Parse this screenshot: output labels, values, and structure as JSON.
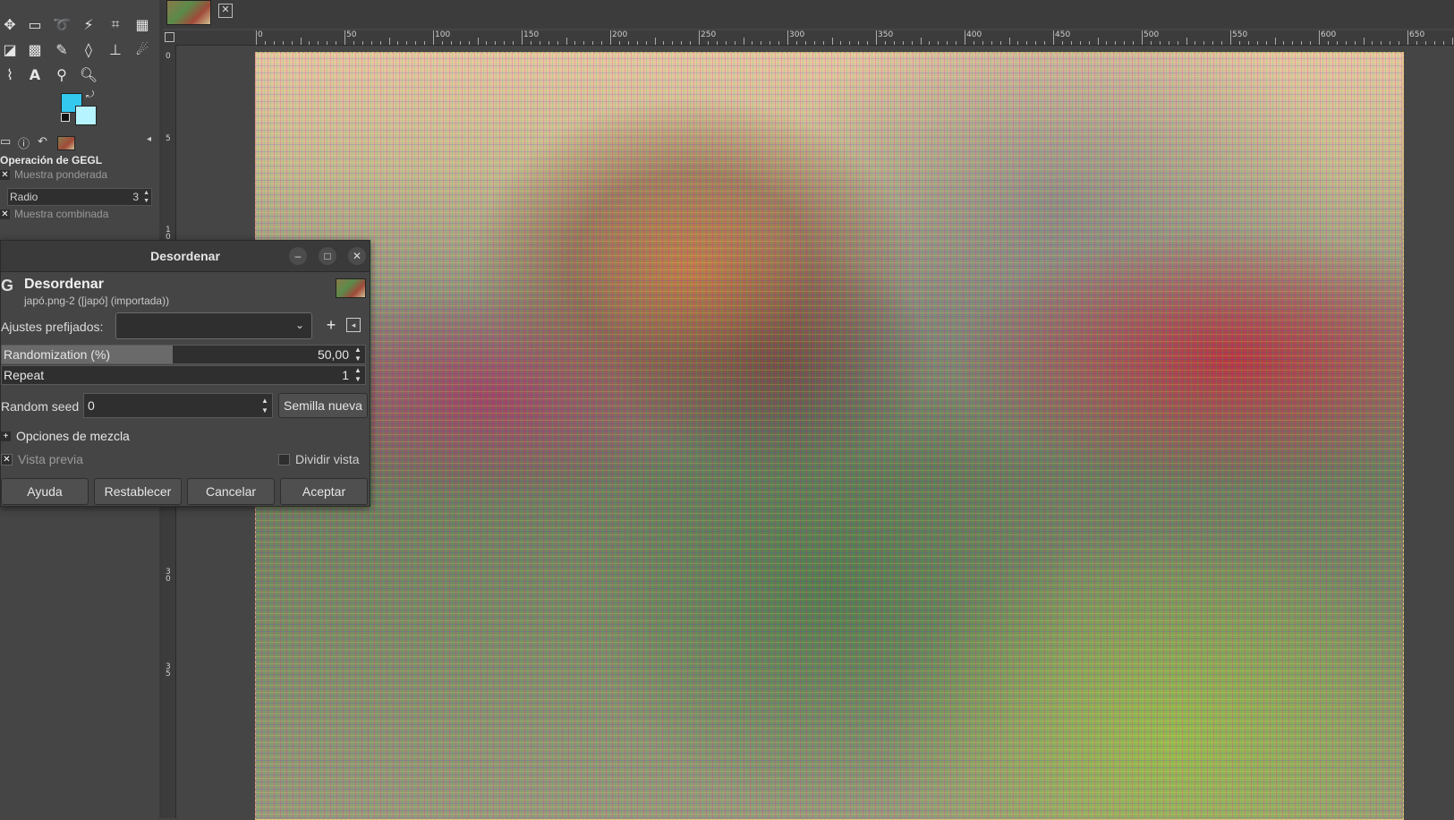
{
  "toolbox": {
    "tools": [
      "move-icon",
      "rect-select-icon",
      "lasso-icon",
      "fuzzy-select-icon",
      "crop-icon",
      "unified-transform-icon",
      "bucket-fill-icon",
      "gradient-icon",
      "paintbrush-icon",
      "eraser-icon",
      "clone-icon",
      "smudge-icon",
      "paths-icon",
      "text-icon",
      "color-picker-icon",
      "zoom-icon"
    ],
    "text_tool_glyph": "A",
    "fg_color": "#33c8ee",
    "bg_color": "#b6f4ff"
  },
  "tool_options": {
    "title": "Operación de GEGL",
    "sample_merged": "Muestra ponderada",
    "radius_label": "Radio",
    "radius_value": "3",
    "sample_combined": "Muestra combinada"
  },
  "image_tab": {
    "close": "✕"
  },
  "ruler": {
    "top_labels": [
      "0",
      "50",
      "100",
      "150",
      "200",
      "250",
      "300",
      "350",
      "400",
      "450",
      "500",
      "550",
      "600",
      "650"
    ],
    "left_labels": [
      "0",
      "5",
      "1",
      "0",
      "3",
      "0",
      "3",
      "5",
      "4",
      "0"
    ]
  },
  "dialog": {
    "title": "Desordenar",
    "op_name": "Desordenar",
    "op_sub": "japó.png-2 ([japó] (importada))",
    "presets_label": "Ajustes prefijados:",
    "presets_value": "",
    "randomization_label": "Randomization (%)",
    "randomization_value": "50,00",
    "randomization_fraction": 0.47,
    "repeat_label": "Repeat",
    "repeat_value": "1",
    "seed_label": "Random seed",
    "seed_value": "0",
    "new_seed": "Semilla nueva",
    "blend_options": "Opciones de mezcla",
    "preview": "Vista previa",
    "split_view": "Dividir vista",
    "buttons": {
      "help": "Ayuda",
      "reset": "Restablecer",
      "cancel": "Cancelar",
      "ok": "Aceptar"
    }
  }
}
